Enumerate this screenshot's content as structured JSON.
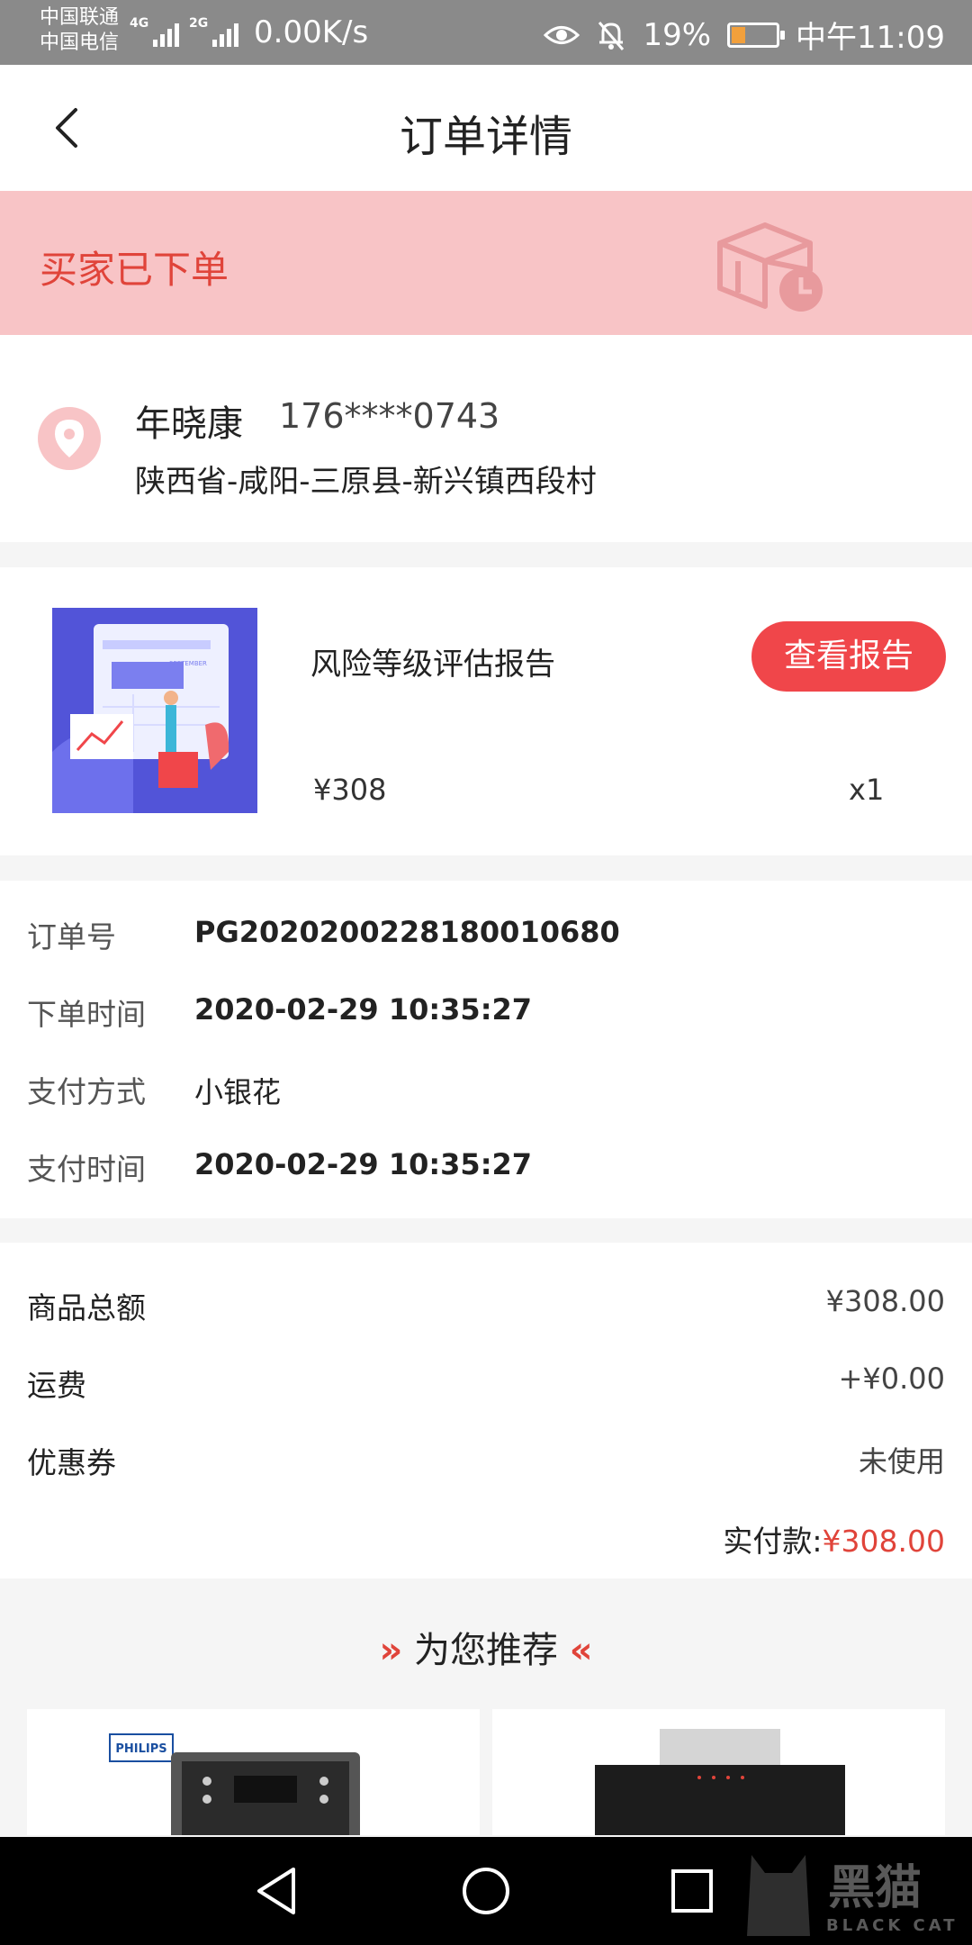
{
  "status_bar": {
    "carrier_1": "中国联通",
    "carrier_2": "中国电信",
    "network_1": "4G",
    "network_2": "2G",
    "speed": "0.00K/s",
    "battery_percent": "19%",
    "battery_level": 0.19,
    "time": "中午11:09"
  },
  "header": {
    "title": "订单详情"
  },
  "banner": {
    "status_text": "买家已下单"
  },
  "address": {
    "name": "年晓康",
    "phone": "176****0743",
    "address": "陕西省-咸阳-三原县-新兴镇西段村"
  },
  "product": {
    "name": "风险等级评估报告",
    "action_label": "查看报告",
    "price": "¥308",
    "quantity": "x1",
    "thumbnail_caption": "SEPTEMBER"
  },
  "order_info": {
    "rows": [
      {
        "label": "订单号",
        "value": "PG2020200228180010680"
      },
      {
        "label": "下单时间",
        "value": "2020-02-29 10:35:27"
      },
      {
        "label": "支付方式",
        "value": "小银花"
      },
      {
        "label": "支付时间",
        "value": "2020-02-29 10:35:27"
      }
    ]
  },
  "totals": {
    "rows": [
      {
        "label": "商品总额",
        "value": "¥308.00"
      },
      {
        "label": "运费",
        "value": "+¥0.00"
      },
      {
        "label": "优惠券",
        "value": "未使用"
      }
    ],
    "paid_label": "实付款:",
    "paid_amount": "¥308.00"
  },
  "recommend": {
    "title": "为您推荐",
    "card_1_brand": "PHILIPS"
  },
  "watermark": {
    "text": "黑猫",
    "sub": "BLACK CAT"
  },
  "colors": {
    "accent": "#e0443a",
    "banner_bg": "#f8c4c6",
    "button": "#f0464a"
  }
}
